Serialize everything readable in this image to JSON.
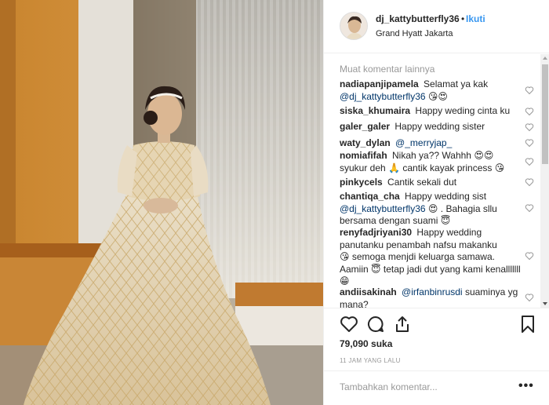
{
  "post": {
    "username": "dj_kattybutterfly36",
    "follow_separator": "•",
    "follow_label": "Ikuti",
    "location": "Grand Hyatt Jakarta"
  },
  "comments": {
    "load_more": "Muat komentar lainnya",
    "items": [
      {
        "user": "nadiapanjipamela",
        "text": "Selamat ya kak",
        "mention": "@dj_kattybutterfly36",
        "rest": ""
      },
      {
        "user": "siska_khumaira",
        "text": "Happy weding cinta ku",
        "mention": "",
        "rest": ""
      },
      {
        "user": "galer_galer",
        "text": "Happy wedding sister",
        "mention": "",
        "rest": ""
      },
      {
        "user": "waty_dylan",
        "text": "",
        "mention": "@_merryjap_",
        "rest": ""
      },
      {
        "user": "nomiafifah",
        "text": "Nikah ya?? Wahhh",
        "mention": "",
        "rest": "syukur deh",
        "rest2": "cantik kayak princess"
      },
      {
        "user": "pinkycels",
        "text": "Cantik sekali dut",
        "mention": "",
        "rest": ""
      },
      {
        "user": "chantiqa_cha",
        "text": "Happy wedding sist",
        "mention": "@dj_kattybutterfly36",
        "rest": ". Bahagia sllu bersama dengan suami"
      },
      {
        "user": "renyfadjriyani30",
        "text": "Happy wedding panutanku penambah nafsu makanku",
        "mention": "",
        "rest": "semoga menjdi keluarga samawa. Aamiin",
        "rest2": "tetap jadi dut yang kami kenalllllll"
      },
      {
        "user": "andiisakinah",
        "text": "",
        "mention": "@irfanbinrusdi",
        "rest": "suaminya yg mana?"
      }
    ]
  },
  "actions": {
    "likes": "79,090 suka",
    "timestamp": "11 JAM YANG LALU"
  },
  "add_comment": {
    "placeholder": "Tambahkan komentar...",
    "more": "•••"
  },
  "colors": {
    "link": "#3897f0",
    "mention": "#003569",
    "muted": "#999999",
    "text": "#262626"
  }
}
